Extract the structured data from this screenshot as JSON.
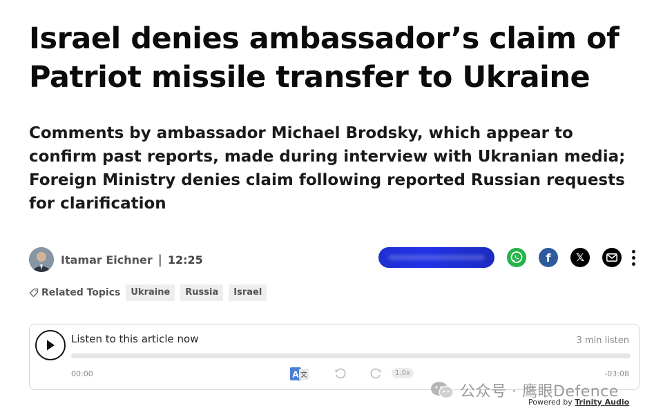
{
  "article": {
    "headline": "Israel denies ambassador’s claim of Patriot missile transfer to Ukraine",
    "subheadline": "Comments by ambassador Michael Brodsky, which appear to confirm past reports, made during interview with Ukranian media; Foreign Ministry denies claim following reported Russian requests for clarification",
    "author": "Itamar Eichner",
    "separator": "|",
    "time": "12:25"
  },
  "share": {
    "icons": [
      "whatsapp-icon",
      "facebook-icon",
      "x-icon",
      "mail-icon",
      "more-icon"
    ],
    "facebook_glyph": "f",
    "x_glyph": "𝕏",
    "colors": {
      "pill": "#2233e6",
      "whatsapp": "#25b34a",
      "facebook": "#2f5a9e",
      "x": "#000000",
      "mail": "#000000"
    }
  },
  "topics": {
    "label": "Related Topics",
    "items": [
      "Ukraine",
      "Russia",
      "Israel"
    ]
  },
  "player": {
    "title": "Listen to this article now",
    "duration": "3 min listen",
    "current_time": "00:00",
    "remaining_time": "-03:08",
    "speed": "1.0x",
    "progress": 0
  },
  "watermark": {
    "text": "公众号 · 鹰眼Defence"
  },
  "powered_by": {
    "prefix": "Powered by",
    "brand": "Trinity Audio"
  }
}
